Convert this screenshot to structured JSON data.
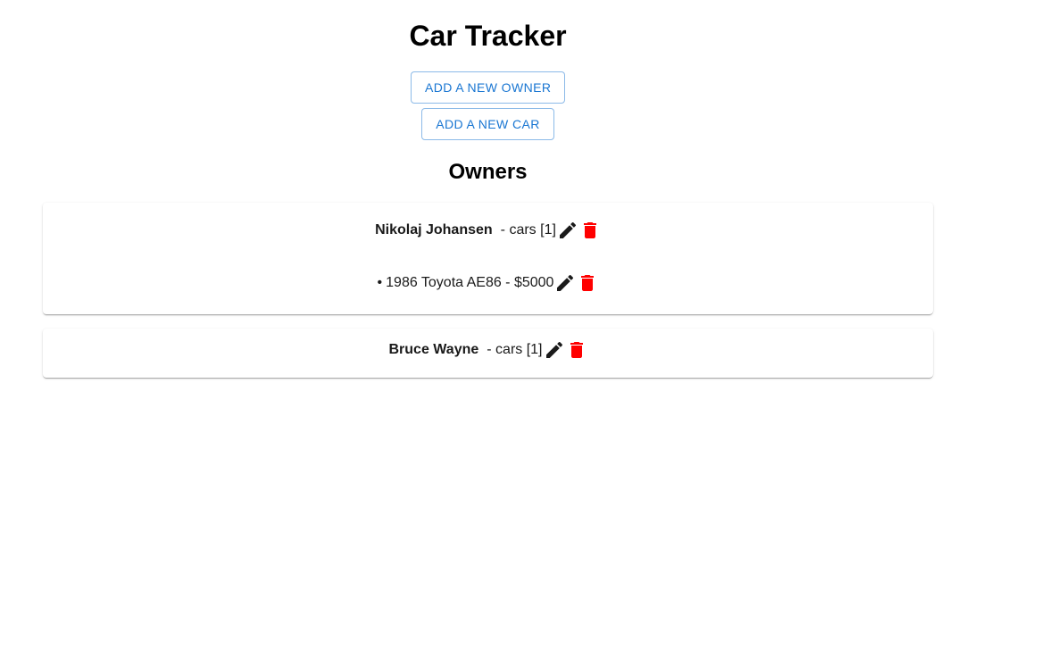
{
  "header": {
    "title": "Car Tracker"
  },
  "actions": {
    "add_owner_label": "ADD A NEW OWNER",
    "add_car_label": "ADD A NEW CAR"
  },
  "owners_section": {
    "title": "Owners"
  },
  "owners": [
    {
      "name": "Nikolaj Johansen",
      "cars_text": "- cars [1]",
      "cars": [
        {
          "bullet": "•",
          "label": "1986 Toyota AE86 - $5000"
        }
      ]
    },
    {
      "name": "Bruce Wayne",
      "cars_text": "- cars [1]",
      "cars": []
    }
  ],
  "icons": {
    "edit": "pencil-icon",
    "delete": "trash-icon"
  },
  "colors": {
    "accent": "#1976d2",
    "delete": "#ff0000",
    "edit": "#1a1a1a"
  }
}
